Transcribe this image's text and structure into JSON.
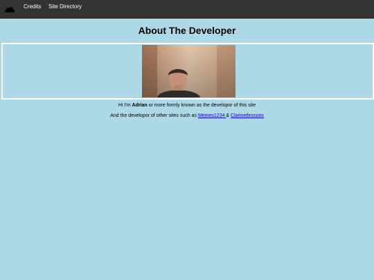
{
  "nav": {
    "logo_icon": "cloud-icon",
    "links": [
      {
        "label": "Credits"
      },
      {
        "label": "Site Directory"
      }
    ]
  },
  "page": {
    "title": "About The Developer",
    "background_color": "#add8e6",
    "navbar_color": "#333333"
  },
  "photo": {
    "subject": "photo of the developer"
  },
  "bio": {
    "line1_prefix": "Hi I'm ",
    "line1_name": "Adrian",
    "line1_suffix": " or more formly known as the developor of this site",
    "line2_prefix": "And the developor of other sites such as ",
    "link1": "Memes1234 ",
    "separator": " & ",
    "link2": "Clarinetlessons"
  }
}
